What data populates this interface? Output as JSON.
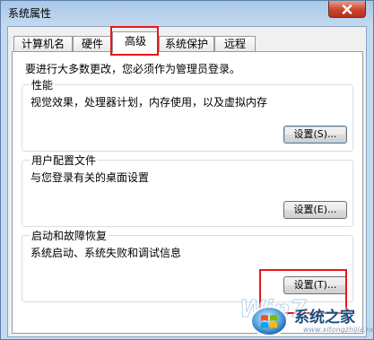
{
  "window": {
    "title": "系统属性",
    "close_icon": "close-x"
  },
  "tabs": [
    {
      "label": "计算机名",
      "active": false
    },
    {
      "label": "硬件",
      "active": false
    },
    {
      "label": "高级",
      "active": true
    },
    {
      "label": "系统保护",
      "active": false
    },
    {
      "label": "远程",
      "active": false
    }
  ],
  "advanced": {
    "admin_note": "要进行大多数更改，您必须作为管理员登录。",
    "performance": {
      "title": "性能",
      "description": "视觉效果，处理器计划，内存使用，以及虚拟内存",
      "button": "设置(S)..."
    },
    "user_profiles": {
      "title": "用户配置文件",
      "description": "与您登录有关的桌面设置",
      "button": "设置(E)..."
    },
    "startup_recovery": {
      "title": "启动和故障恢复",
      "description": "系统启动、系统失败和调试信息",
      "button": "设置(T)..."
    }
  },
  "watermark": {
    "logo_text": "Win7",
    "site_name": "系统之家",
    "url": "www.xitongzhijia.net"
  },
  "colors": {
    "highlight": "#e8161b",
    "title_gradient_top": "#a9c8e6",
    "frame": "#c3d9ef"
  }
}
